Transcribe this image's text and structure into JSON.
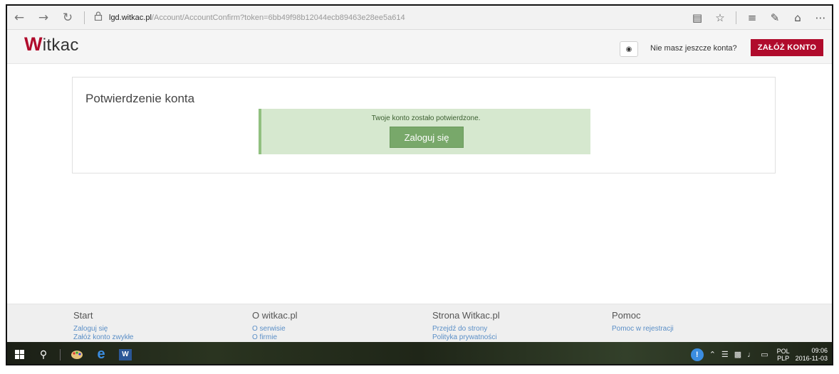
{
  "browser": {
    "url_host": "lgd.witkac.pl",
    "url_path": "/Account/AccountConfirm?token=6bb49f98b12044ecb89463e28ee5a614"
  },
  "header": {
    "logo_initial": "W",
    "logo_rest": "itkac",
    "no_account_text": "Nie masz jeszcze konta?",
    "signup_label": "ZAŁÓŻ KONTO"
  },
  "card": {
    "title": "Potwierdzenie konta",
    "alert_text": "Twoje konto zostało potwierdzone.",
    "login_label": "Zaloguj się"
  },
  "footer": {
    "columns": [
      {
        "title": "Start",
        "links": [
          "Zaloguj się",
          "Załóż konto zwykłe"
        ]
      },
      {
        "title": "O witkac.pl",
        "links": [
          "O serwisie",
          "O firmie"
        ]
      },
      {
        "title": "Strona Witkac.pl",
        "links": [
          "Przejdź do strony",
          "Polityka prywatności"
        ]
      },
      {
        "title": "Pomoc",
        "links": [
          "Pomoc w rejestracji"
        ]
      }
    ]
  },
  "taskbar": {
    "lang_top": "POL",
    "lang_bottom": "PLP",
    "time": "09:06",
    "date": "2016-11-03"
  },
  "colors": {
    "brand": "#b00b2c",
    "success_bg": "#d6e8cf",
    "success_button": "#78a86a",
    "link": "#5b8fc7"
  }
}
